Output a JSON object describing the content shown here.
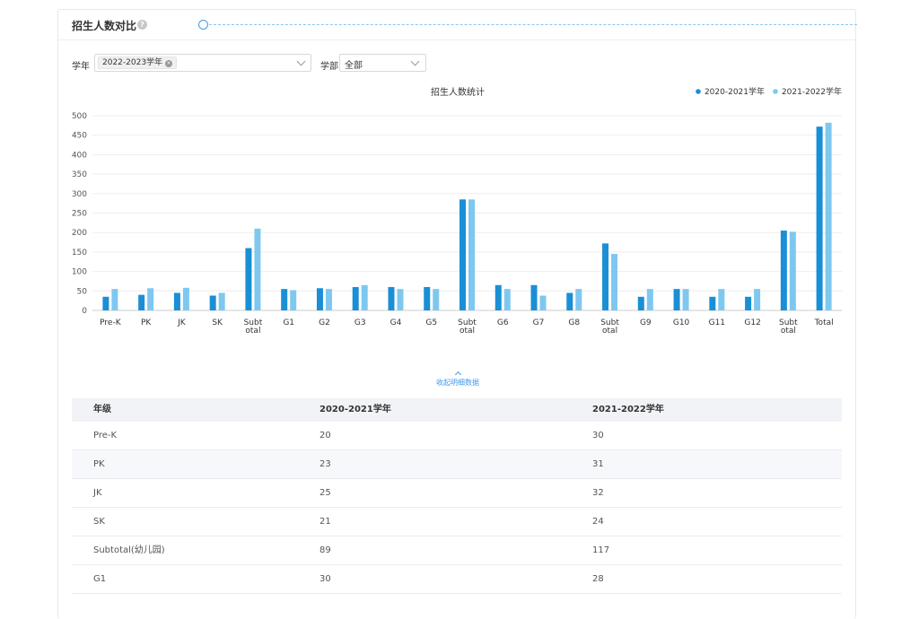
{
  "header": {
    "title": "招生人数对比",
    "help_icon": "question-icon"
  },
  "filters": {
    "year_label": "学年",
    "year_tag": "2022-2023学年",
    "dept_label": "学部",
    "dept_value": "全部"
  },
  "chart_data": {
    "type": "bar",
    "title": "招生人数统计",
    "legend_position": "top-right",
    "categories": [
      "Pre-K",
      "PK",
      "JK",
      "SK",
      "Subt|otal",
      "G1",
      "G2",
      "G3",
      "G4",
      "G5",
      "Subt|otal",
      "G6",
      "G7",
      "G8",
      "Subt|otal",
      "G9",
      "G10",
      "G11",
      "G12",
      "Subt|otal",
      "Total"
    ],
    "series": [
      {
        "name": "2020-2021学年",
        "color": "#1a8fd6",
        "values": [
          35,
          40,
          45,
          38,
          160,
          55,
          57,
          60,
          60,
          60,
          285,
          65,
          65,
          45,
          172,
          35,
          55,
          35,
          35,
          205,
          472
        ]
      },
      {
        "name": "2021-2022学年",
        "color": "#7ec8f0",
        "values": [
          55,
          57,
          58,
          45,
          210,
          52,
          55,
          65,
          55,
          55,
          285,
          55,
          38,
          55,
          145,
          55,
          55,
          55,
          55,
          202,
          482
        ]
      }
    ],
    "ylim": [
      0,
      500
    ],
    "yticks": [
      0,
      50,
      100,
      150,
      200,
      250,
      300,
      350,
      400,
      450,
      500
    ],
    "grid": true
  },
  "collapse_label": "收起明细数据",
  "table": {
    "headers": [
      "年级",
      "2020-2021学年",
      "2021-2022学年"
    ],
    "rows": [
      [
        "Pre-K",
        "20",
        "30"
      ],
      [
        "PK",
        "23",
        "31"
      ],
      [
        "JK",
        "25",
        "32"
      ],
      [
        "SK",
        "21",
        "24"
      ],
      [
        "Subtotal(幼儿园)",
        "89",
        "117"
      ],
      [
        "G1",
        "30",
        "28"
      ]
    ]
  }
}
